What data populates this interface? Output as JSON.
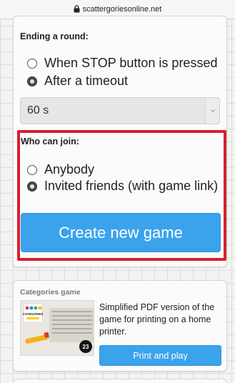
{
  "browser": {
    "url": "scattergoriesonline.net"
  },
  "ending": {
    "heading": "Ending a round:",
    "options": [
      {
        "label": "When STOP button is pressed",
        "checked": false
      },
      {
        "label": "After a timeout",
        "checked": true
      }
    ],
    "timeout_value": "60 s"
  },
  "join": {
    "heading": "Who can join:",
    "options": [
      {
        "label": "Anybody",
        "checked": false
      },
      {
        "label": "Invited friends (with game link)",
        "checked": true
      }
    ],
    "create_label": "Create new game"
  },
  "categories_game": {
    "title": "Categories game",
    "description": "Simplified PDF version of the game for printing on a home printer.",
    "print_label": "Print and play",
    "thumb_text": "CATEGORIES",
    "thumb_badge": "23"
  },
  "colors": {
    "accent": "#3ba3ec",
    "highlight": "#d91f2b"
  }
}
